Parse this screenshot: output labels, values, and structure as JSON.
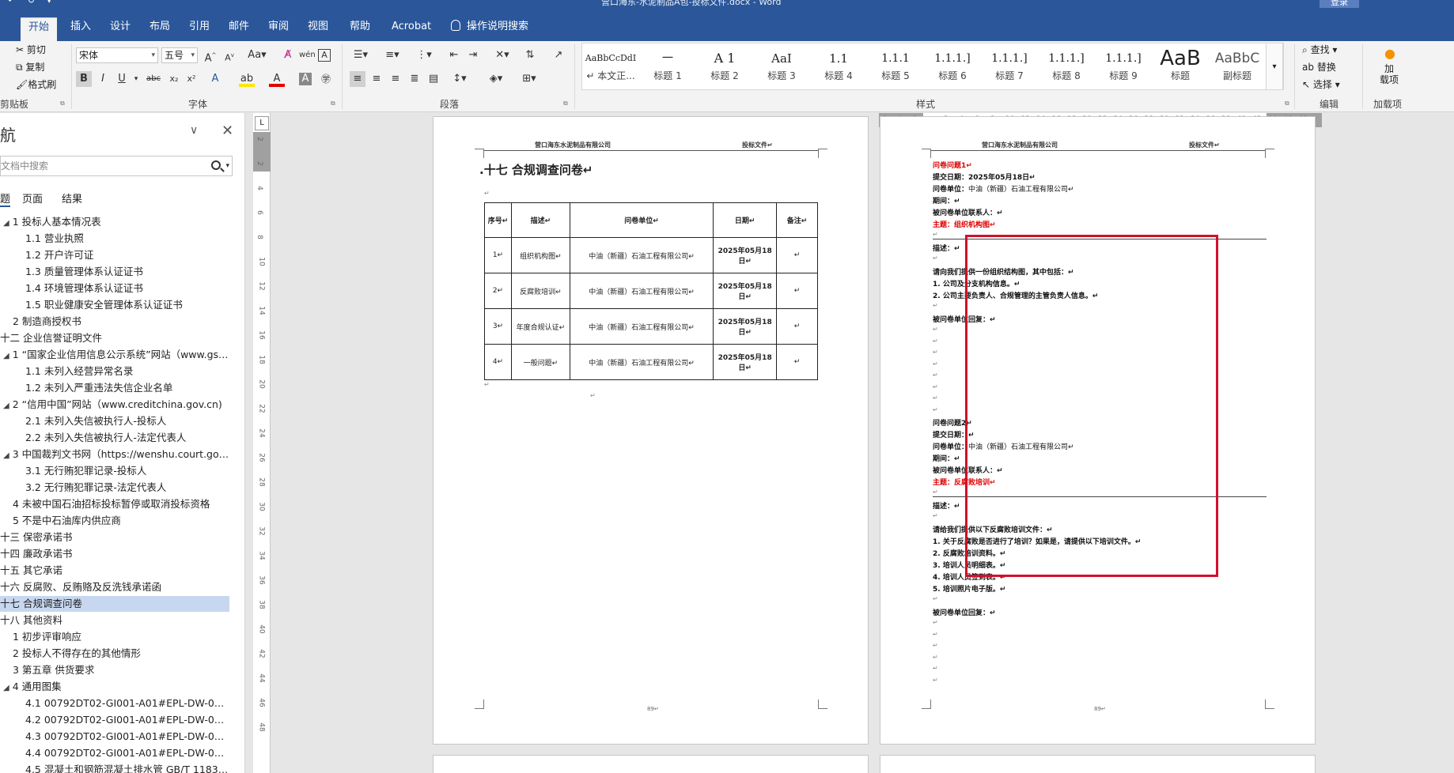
{
  "window": {
    "title": "营口海东-水泥制品A包-投标文件.docx - Word",
    "login_label": "登录",
    "qat": "↶  ↻  ▾"
  },
  "ribbon": {
    "tabs": [
      "开始",
      "插入",
      "设计",
      "布局",
      "引用",
      "邮件",
      "审阅",
      "视图",
      "帮助",
      "Acrobat"
    ],
    "tell_me": "操作说明搜索",
    "clipboard": {
      "cut": "剪切",
      "copy": "复制",
      "painter": "格式刷",
      "label": "剪贴板"
    },
    "font": {
      "name": "宋体",
      "size": "五号",
      "label": "字体"
    },
    "paragraph_label": "段落",
    "styles_label": "样式",
    "styles": [
      {
        "sample": "AaBbCcDdI",
        "name": "↵ 本文正..."
      },
      {
        "sample": "一",
        "name": "标题 1"
      },
      {
        "sample": "A 1",
        "name": "标题 2"
      },
      {
        "sample": "AaI",
        "name": "标题 3"
      },
      {
        "sample": "1.1",
        "name": "标题 4"
      },
      {
        "sample": "1.1.1",
        "name": "标题 5"
      },
      {
        "sample": "1.1.1.]",
        "name": "标题 6"
      },
      {
        "sample": "1.1.1.]",
        "name": "标题 7"
      },
      {
        "sample": "1.1.1.]",
        "name": "标题 8"
      },
      {
        "sample": "1.1.1.]",
        "name": "标题 9"
      },
      {
        "sample": "1.1.1.]",
        "name": "标题"
      },
      {
        "sample": "AaB",
        "name": "标题"
      },
      {
        "sample": "AaBbC",
        "name": "副标题"
      }
    ],
    "editing": {
      "find": "查找",
      "replace": "替换",
      "select": "选择",
      "label": "编辑"
    },
    "addins": {
      "btn": "加\n载项",
      "label": "加载项"
    }
  },
  "nav": {
    "title": "航",
    "search_placeholder": "文档中搜索",
    "tabs": [
      "题",
      "页面",
      "结果"
    ],
    "items": [
      {
        "text": "1 投标人基本情况表",
        "level": 1,
        "tri": true
      },
      {
        "text": "1.1 营业执照",
        "level": 2
      },
      {
        "text": "1.2 开户许可证",
        "level": 2
      },
      {
        "text": "1.3 质量管理体系认证证书",
        "level": 2
      },
      {
        "text": "1.4 环境管理体系认证证书",
        "level": 2
      },
      {
        "text": "1.5 职业健康安全管理体系认证证书",
        "level": 2
      },
      {
        "text": "2 制造商授权书",
        "level": 1
      },
      {
        "text": "十二 企业信誉证明文件",
        "level": 0
      },
      {
        "text": "1 “国家企业信用信息公示系统”网站（www.gsxt...",
        "level": 1,
        "tri": true
      },
      {
        "text": "1.1 未列入经营异常名录",
        "level": 2
      },
      {
        "text": "1.2 未列入严重违法失信企业名单",
        "level": 2
      },
      {
        "text": "2 “信用中国”网站（www.creditchina.gov.cn)",
        "level": 1,
        "tri": true
      },
      {
        "text": "2.1 未列入失信被执行人-投标人",
        "level": 2
      },
      {
        "text": "2.2 未列入失信被执行人-法定代表人",
        "level": 2
      },
      {
        "text": "3 中国裁判文书网（https://wenshu.court.gov....",
        "level": 1,
        "tri": true
      },
      {
        "text": "3.1 无行贿犯罪记录-投标人",
        "level": 2
      },
      {
        "text": "3.2 无行贿犯罪记录-法定代表人",
        "level": 2
      },
      {
        "text": "4 未被中国石油招标投标暂停或取消投标资格",
        "level": 1
      },
      {
        "text": "5 不是中石油库内供应商",
        "level": 1
      },
      {
        "text": "十三 保密承诺书",
        "level": 0
      },
      {
        "text": "十四 廉政承诺书",
        "level": 0
      },
      {
        "text": "十五 其它承诺",
        "level": 0
      },
      {
        "text": "十六 反腐败、反贿赂及反洗钱承诺函",
        "level": 0
      },
      {
        "text": "十七 合规调查问卷",
        "level": 0,
        "selected": true
      },
      {
        "text": "十八 其他资料",
        "level": 0
      },
      {
        "text": "1 初步评审响应",
        "level": 1
      },
      {
        "text": "2 投标人不得存在的其他情形",
        "level": 1
      },
      {
        "text": "3 第五章 供货要求",
        "level": 1
      },
      {
        "text": "4 通用图集",
        "level": 1,
        "tri": true
      },
      {
        "text": "4.1 00792DT02-GI001-A01#EPL-DW-0113...",
        "level": 2
      },
      {
        "text": "4.2 00792DT02-GI001-A01#EPL-DW-0119...",
        "level": 2
      },
      {
        "text": "4.3 00792DT02-GI001-A01#EPL-DW-0165...",
        "level": 2
      },
      {
        "text": "4.4 00792DT02-GI001-A01#EPL-DW-0167...",
        "level": 2
      },
      {
        "text": "4.5 混凝土和钢筋混凝土排水管 GB/T 11836...",
        "level": 2
      }
    ]
  },
  "rulers": {
    "vertical": [
      "2",
      "2",
      "4",
      "6",
      "8",
      "10",
      "12",
      "14",
      "16",
      "18",
      "20",
      "22",
      "24",
      "26",
      "28",
      "30",
      "32",
      "34",
      "36",
      "38",
      "40",
      "42",
      "44",
      "46",
      "48"
    ],
    "horizontal": [
      "6",
      "4",
      "2",
      "",
      "2",
      "4",
      "6",
      "8",
      "10",
      "12",
      "14",
      "16",
      "18",
      "20",
      "22",
      "24",
      "26",
      "28",
      "30",
      "32",
      "34",
      "36",
      "38",
      "40",
      "42",
      "44",
      "46",
      "48"
    ]
  },
  "page1": {
    "header_left": "营口海东水泥制品有限公司",
    "header_right": "投标文件↵",
    "section_title": ".十七  合规调查问卷↵",
    "table_headers": [
      "序号↵",
      "描述↵",
      "问卷单位↵",
      "日期↵",
      "备注↵"
    ],
    "rows": [
      [
        "1↵",
        "组织机构图↵",
        "中油（新疆）石油工程有限公司↵",
        "2025年05月18日↵",
        "↵"
      ],
      [
        "2↵",
        "反腐败培训↵",
        "中油（新疆）石油工程有限公司↵",
        "2025年05月18日↵",
        "↵"
      ],
      [
        "3↵",
        "年度合规认证↵",
        "中油（新疆）石油工程有限公司↵",
        "2025年05月18日↵",
        "↵"
      ],
      [
        "4↵",
        "一般问题↵",
        "中油（新疆）石油工程有限公司↵",
        "2025年05月18日↵",
        "↵"
      ]
    ],
    "page_number": "89↵"
  },
  "page2": {
    "header_left": "营口海东水泥制品有限公司",
    "header_right": "投标文件↵",
    "q1_title": "问卷问题1↵",
    "submit_date": "提交日期：2025年05月18日↵",
    "unit_label": "问卷单位：",
    "unit_value": "中油（新疆）石油工程有限公司↵",
    "period": "期间：↵",
    "contact": "被问卷单位联系人：↵",
    "topic1": "主题：组织机构图↵",
    "desc": "描述：↵",
    "q1_intro": "请向我们提供一份组织结构图，其中包括：↵",
    "q1_items": [
      "1.  公司及分支机构信息。↵",
      "2.  公司主要负责人、合规管理的主管负责人信息。↵"
    ],
    "reply": "被问卷单位回复：↵",
    "q2_title": "问卷问题2↵",
    "submit_date2": "提交日期：↵",
    "topic2": "主题：反腐败培训↵",
    "q2_intro": "请给我们提供以下反腐败培训文件：↵",
    "q2_items": [
      "1.  关于反腐败是否进行了培训？如果是，请提供以下培训文件。↵",
      "2.  反腐败培训资料。↵",
      "3.  培训人员明细表。↵",
      "4.  培训人员签到表。↵",
      "5.  培训照片电子版。↵"
    ],
    "page_number": "89↵"
  },
  "colors": {
    "accent": "#2b579a",
    "highlight": "#d0112b",
    "red_text": "#e00000"
  }
}
